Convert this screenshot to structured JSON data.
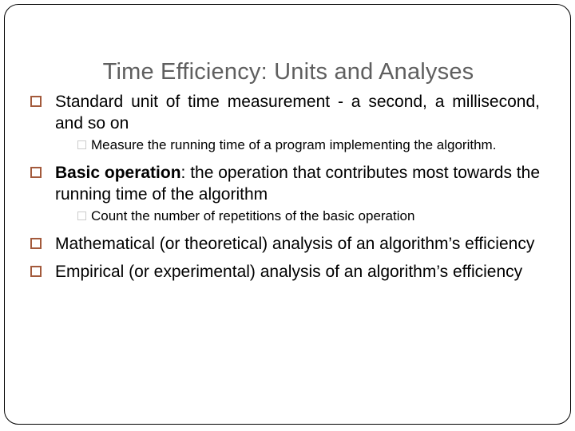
{
  "slide": {
    "title": "Time Efficiency: Units and Analyses",
    "colors": {
      "title": "#5f5f5f",
      "level1_bullet": "#a35a3c",
      "level2_bullet": "#cccccc",
      "text": "#000000"
    },
    "bullets": [
      {
        "level": 1,
        "text": "Standard unit of time measurement - a second, a millisecond, and so on",
        "children": [
          {
            "level": 2,
            "text": "Measure the running time of a program implementing the algorithm."
          }
        ]
      },
      {
        "level": 1,
        "bold_prefix": "Basic operation",
        "text": ": the operation that contributes most towards the running time of the algorithm",
        "children": [
          {
            "level": 2,
            "text": "Count the number of repetitions of the basic operation"
          }
        ]
      },
      {
        "level": 1,
        "text": "Mathematical (or theoretical) analysis of an algorithm’s efficiency",
        "children": []
      },
      {
        "level": 1,
        "text": "Empirical (or experimental) analysis of an algorithm’s efficiency",
        "children": []
      }
    ]
  }
}
